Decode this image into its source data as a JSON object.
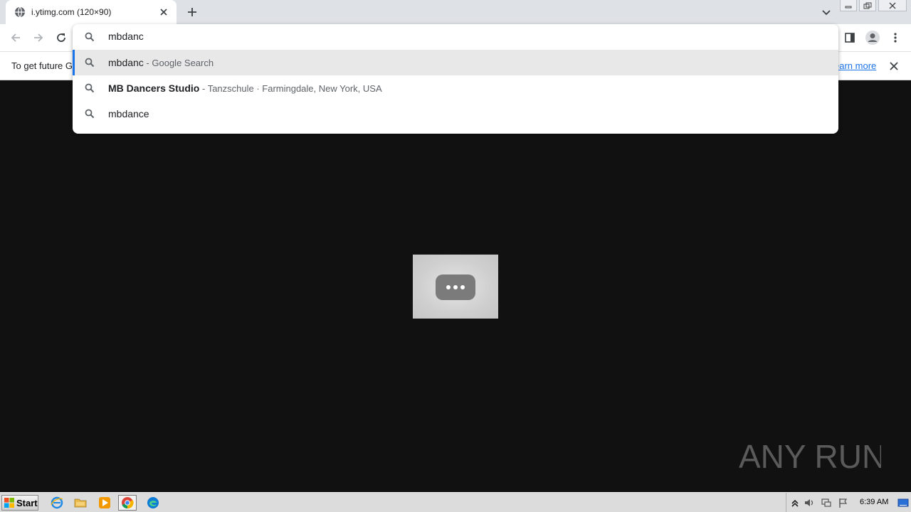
{
  "tab": {
    "title": "i.ytimg.com (120×90)"
  },
  "omnibox": {
    "input_value": "mbdanc",
    "suggestions": [
      {
        "main": "mbdanc",
        "detail": "Google Search",
        "selected": true
      },
      {
        "main": "MB Dancers Studio",
        "detail": "Tanzschule · Farmingdale, New York, USA",
        "selected": false
      },
      {
        "main": "mbdance",
        "detail": "",
        "selected": false
      }
    ]
  },
  "infobar": {
    "text": "To get future G",
    "link": "earn more"
  },
  "taskbar": {
    "start_label": "Start",
    "clock": "6:39 AM"
  },
  "watermark": {
    "text": "ANY RUN"
  },
  "colors": {
    "accent": "#1a73e8",
    "page_background": "#111111",
    "tab_strip": "#dee1e6",
    "selected_row": "#e8e8e9"
  },
  "icons": {
    "tab": [
      "globe-icon",
      "close-icon",
      "plus-icon",
      "chevron-down-icon"
    ],
    "toolbar": [
      "back-arrow-icon",
      "forward-arrow-icon",
      "reload-icon",
      "side-panel-icon",
      "profile-icon",
      "kebab-menu-icon"
    ],
    "omnibox": [
      "search-icon"
    ],
    "taskbar": [
      "windows-flag-icon",
      "internet-explorer-icon",
      "folder-icon",
      "media-player-icon",
      "chrome-icon",
      "edge-icon",
      "tray-arrow-icon",
      "speaker-icon",
      "network-icon",
      "flag-icon",
      "show-desktop-icon"
    ]
  }
}
